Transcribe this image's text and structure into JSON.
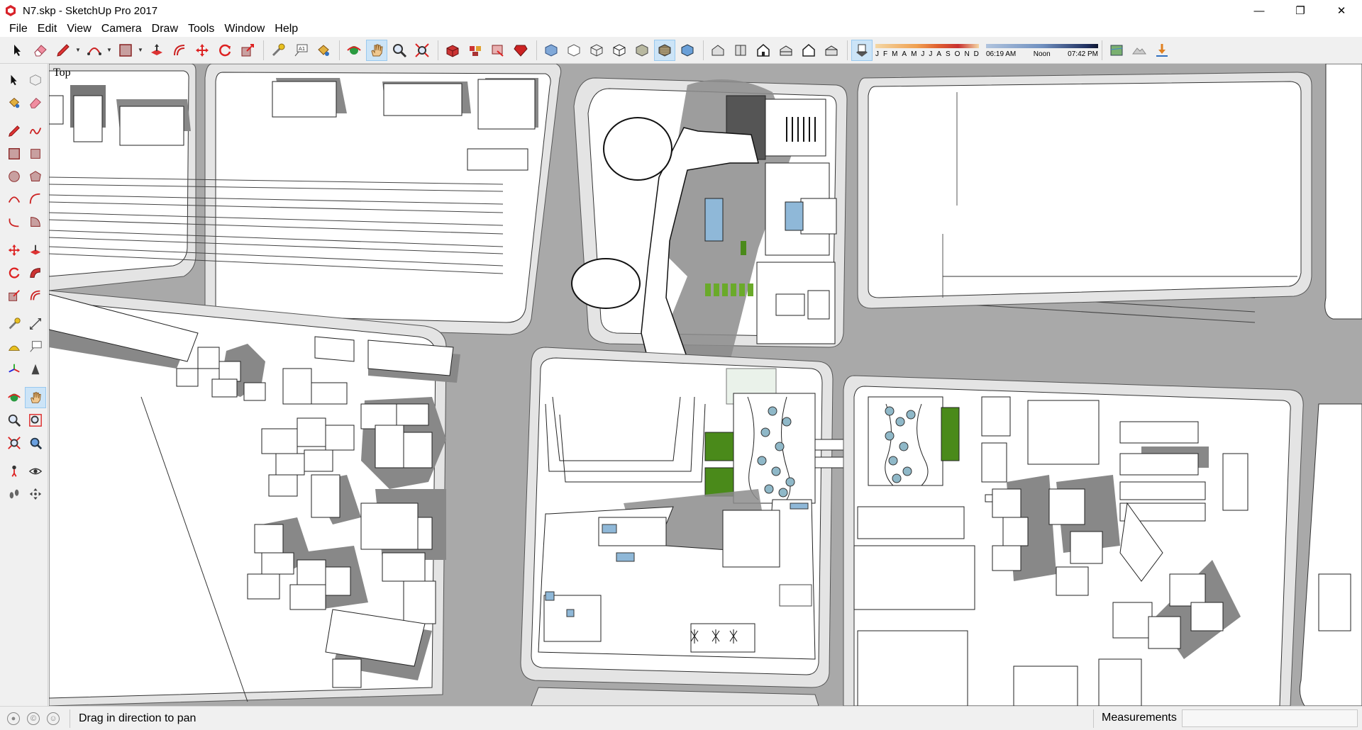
{
  "window": {
    "title": "N7.skp - SketchUp Pro 2017",
    "minimize_glyph": "—",
    "maximize_glyph": "❐",
    "close_glyph": "✕"
  },
  "menu": [
    "File",
    "Edit",
    "View",
    "Camera",
    "Draw",
    "Tools",
    "Window",
    "Help"
  ],
  "shadow_settings": {
    "months": [
      "J",
      "F",
      "M",
      "A",
      "M",
      "J",
      "J",
      "A",
      "S",
      "O",
      "N",
      "D"
    ],
    "time_start": "06:19 AM",
    "time_mid": "Noon",
    "time_end": "07:42 PM"
  },
  "viewport": {
    "view_label": "Top"
  },
  "status": {
    "hint": "Drag in direction to pan",
    "measurements_label": "Measurements",
    "measurements_value": ""
  },
  "colors": {
    "accent": "#cce4f7",
    "road": "#a9a9a9",
    "sidewalk": "#e4e4e4",
    "shadow": "#8c8c8c",
    "green_roof": "#4a8a1a"
  },
  "icons": {
    "app": "sketchup-logo-icon",
    "select": "select-arrow-icon",
    "eraser": "eraser-icon",
    "pencil": "pencil-line-icon",
    "orbit": "orbit-icon",
    "pan": "pan-hand-icon",
    "zoom": "zoom-icon"
  }
}
